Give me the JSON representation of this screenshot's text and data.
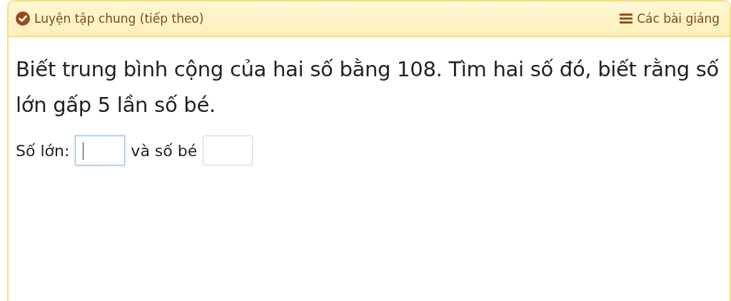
{
  "header": {
    "title": "Luyện tập chung (tiếp theo)",
    "completed": true,
    "lessons_link": "Các bài giảng"
  },
  "question": "Biết trung bình cộng của hai số bằng 108. Tìm hai số đó, biết rằng số lớn gấp 5 lần số bé.",
  "answer": [
    {
      "kind": "text",
      "text": "Số lớn:"
    },
    {
      "kind": "input",
      "focused": true
    },
    {
      "kind": "text",
      "text": "và số bé"
    },
    {
      "kind": "input",
      "focused": false
    }
  ]
}
